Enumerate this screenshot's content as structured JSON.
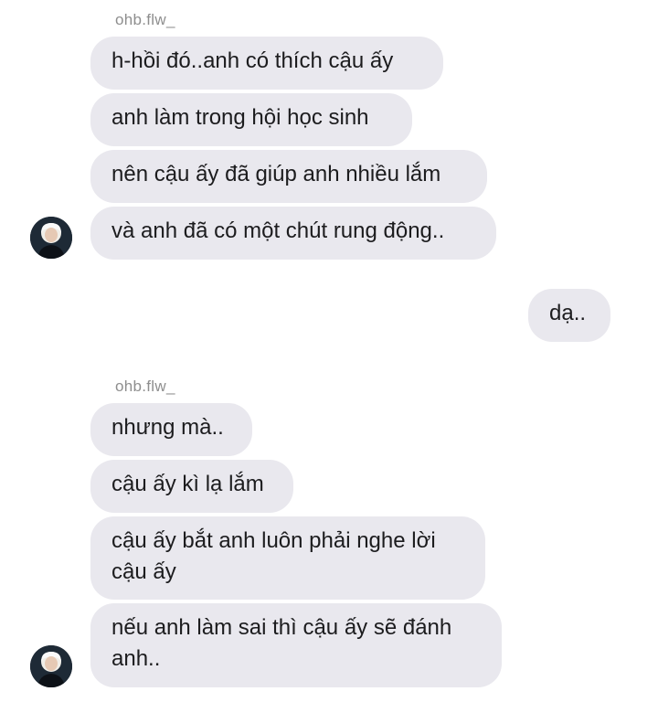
{
  "groups": [
    {
      "sender": "ohb.flw_",
      "messages": [
        "h-hồi đó..anh có thích cậu ấy",
        "anh làm trong hội học sinh",
        "nên cậu ấy đã giúp anh nhiều lắm",
        "và anh đã có một chút rung động.."
      ]
    },
    {
      "sender": "ohb.flw_",
      "messages": [
        "nhưng mà..",
        "cậu ấy kì lạ lắm",
        "cậu ấy bắt anh luôn phải nghe lời cậu ấy",
        "nếu anh làm sai thì cậu ấy sẽ đánh anh.."
      ]
    }
  ],
  "outgoing": [
    "dạ.."
  ],
  "icons": {
    "avatar": "profile-avatar"
  },
  "colors": {
    "bubble": "#e9e8ee",
    "text": "#1c1c1e",
    "sender": "#8e8e8e",
    "background": "#ffffff"
  }
}
